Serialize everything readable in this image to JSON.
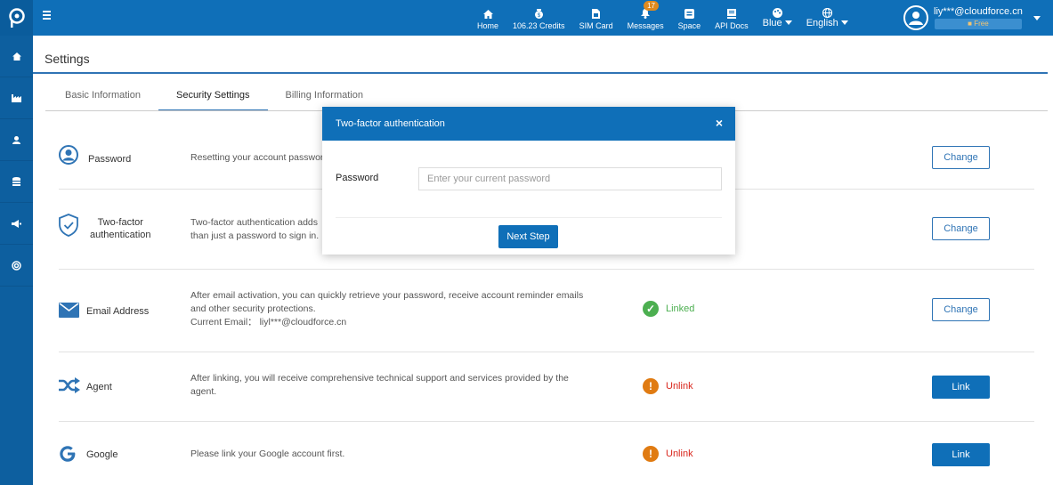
{
  "topnav": {
    "items": [
      {
        "label": "Home",
        "icon": "home-icon"
      },
      {
        "label": "106.23 Credits",
        "icon": "credits-icon"
      },
      {
        "label": "SIM Card",
        "icon": "sim-card-icon"
      },
      {
        "label": "Messages",
        "icon": "bell-icon",
        "badge": "17"
      },
      {
        "label": "Space",
        "icon": "space-icon"
      },
      {
        "label": "API Docs",
        "icon": "api-docs-icon"
      }
    ],
    "theme_label": "Blue",
    "language_label": "English"
  },
  "user": {
    "email": "liy***@cloudforce.cn",
    "plan": "Free"
  },
  "sidebar": {
    "items": [
      {
        "icon": "home-icon"
      },
      {
        "icon": "factory-icon"
      },
      {
        "icon": "user-icon"
      },
      {
        "icon": "database-icon"
      },
      {
        "icon": "megaphone-icon"
      },
      {
        "icon": "support-icon"
      }
    ]
  },
  "page": {
    "title": "Settings",
    "tabs": [
      {
        "label": "Basic Information",
        "active": false
      },
      {
        "label": "Security Settings",
        "active": true
      },
      {
        "label": "Billing Information",
        "active": false
      }
    ]
  },
  "security": {
    "rows": [
      {
        "name": "Password",
        "desc": "Resetting your account password",
        "status": "",
        "action": "Change"
      },
      {
        "name": "Two-factor authentication",
        "name_line1": "Two-factor",
        "name_line2": "authentication",
        "desc_line1": "Two-factor authentication adds",
        "desc_line2": "than just a password to sign in.",
        "status": "",
        "action": "Change"
      },
      {
        "name": "Email Address",
        "desc_line1": "After email activation, you can quickly retrieve your password, receive account reminder emails",
        "desc_line2": "and other security protections.",
        "desc_line3": "Current Email： liyl***@cloudforce.cn",
        "status": "Linked",
        "action": "Change"
      },
      {
        "name": "Agent",
        "desc_line1": "After linking, you will receive comprehensive technical support and services provided by the",
        "desc_line2": "agent.",
        "status": "Unlink",
        "action": "Link"
      },
      {
        "name": "Google",
        "desc": "Please link your Google account first.",
        "status": "Unlink",
        "action": "Link"
      }
    ]
  },
  "modal": {
    "title": "Two-factor authentication",
    "close": "×",
    "field_label": "Password",
    "field_placeholder": "Enter your current password",
    "field_value": "",
    "next_label": "Next Step"
  },
  "colors": {
    "primary": "#0f6fb8",
    "linked": "#4caf50",
    "unlink_icon": "#e07b12",
    "unlink_text": "#d9261c",
    "linked_text": "#4caf50"
  }
}
